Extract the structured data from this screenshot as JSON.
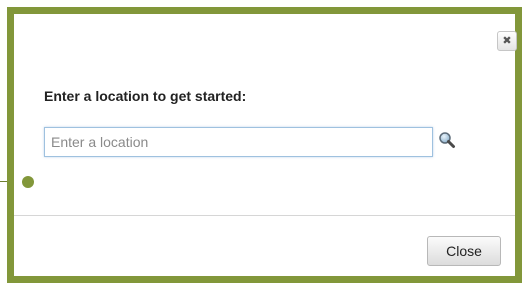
{
  "dialog": {
    "close_x_glyph": "✖",
    "heading": "Enter a location to get started:",
    "location_input": {
      "placeholder": "Enter a location",
      "value": ""
    },
    "search_icon": "magnifier-icon",
    "close_button_label": "Close"
  },
  "colors": {
    "frame_border": "#82973a",
    "input_focus_border": "#9fc1df"
  }
}
